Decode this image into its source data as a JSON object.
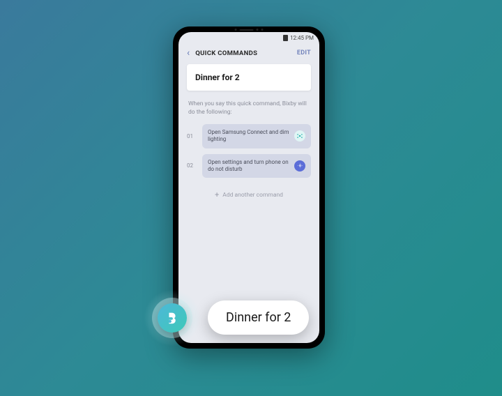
{
  "status": {
    "time": "12:45 PM"
  },
  "nav": {
    "title": "QUICK COMMANDS",
    "edit": "EDIT"
  },
  "card": {
    "title": "Dinner for 2"
  },
  "instruction": "When you say this quick command, Bixby will do the following:",
  "commands": {
    "n1": "01",
    "t1": "Open Samsung Connect and dim lighting",
    "n2": "02",
    "t2": "Open settings and turn phone on do not disturb"
  },
  "add": {
    "label": "Add another command"
  },
  "bubble": {
    "text": "Dinner for 2"
  }
}
